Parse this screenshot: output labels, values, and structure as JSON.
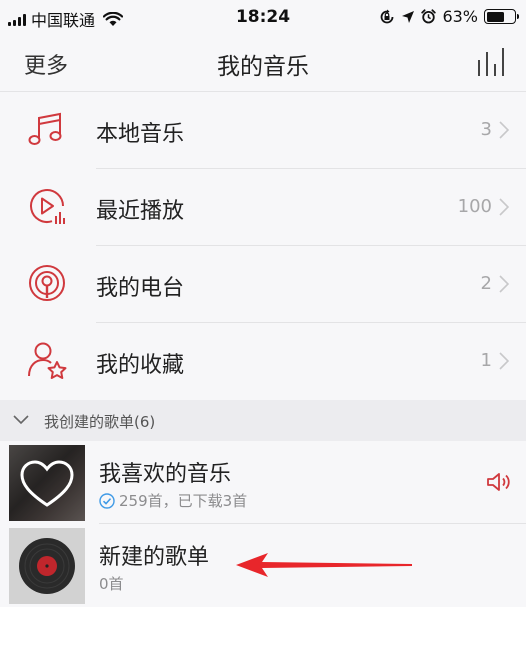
{
  "status_bar": {
    "carrier": "中国联通",
    "time": "18:24",
    "battery": "63%",
    "battery_level": 0.63
  },
  "nav": {
    "left_label": "更多",
    "title": "我的音乐",
    "right_icon": "equalizer-bars-icon"
  },
  "menu": {
    "items": [
      {
        "label": "本地音乐",
        "count": "3",
        "icon": "music-note-icon"
      },
      {
        "label": "最近播放",
        "count": "100",
        "icon": "recent-play-icon"
      },
      {
        "label": "我的电台",
        "count": "2",
        "icon": "radio-icon"
      },
      {
        "label": "我的收藏",
        "count": "1",
        "icon": "favorite-person-star-icon"
      }
    ]
  },
  "section": {
    "title": "我创建的歌单(6)"
  },
  "playlists": [
    {
      "name": "我喜欢的音乐",
      "sub": "259首，已下载3首",
      "icon": "heart-icon"
    },
    {
      "name": "新建的歌单",
      "sub": "0首",
      "icon": "vinyl-record-icon"
    }
  ],
  "colors": {
    "accent": "#d0393e",
    "background": "#f7f7f9",
    "section_bg": "#ececef",
    "secondary_text": "#a7a7a9",
    "download_check": "#3f9ae6"
  }
}
